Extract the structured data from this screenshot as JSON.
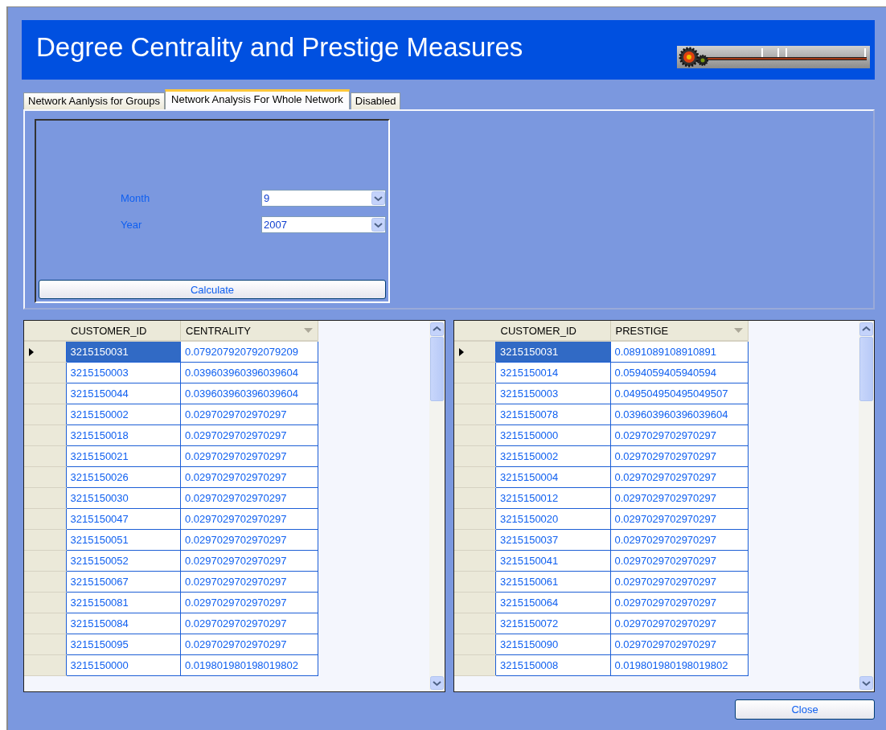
{
  "header": {
    "title": "Degree Centrality and Prestige Measures"
  },
  "tabs": [
    {
      "label": "Network Aanlysis for Groups",
      "selected": false
    },
    {
      "label": "Network Analysis For Whole Network",
      "selected": true
    },
    {
      "label": "Disabled",
      "selected": false
    }
  ],
  "form": {
    "fields": [
      {
        "label": "Month",
        "value": "9"
      },
      {
        "label": "Year",
        "value": "2007"
      }
    ],
    "calculate_button": "Calculate"
  },
  "grids": [
    {
      "columns": [
        "CUSTOMER_ID",
        "CENTRALITY"
      ],
      "rows": [
        {
          "cells": [
            "3215150031",
            "0.079207920792079209"
          ],
          "selected": true
        },
        {
          "cells": [
            "3215150003",
            "0.039603960396039604"
          ],
          "selected": false
        },
        {
          "cells": [
            "3215150044",
            "0.039603960396039604"
          ],
          "selected": false
        },
        {
          "cells": [
            "3215150002",
            "0.0297029702970297"
          ],
          "selected": false
        },
        {
          "cells": [
            "3215150018",
            "0.0297029702970297"
          ],
          "selected": false
        },
        {
          "cells": [
            "3215150021",
            "0.0297029702970297"
          ],
          "selected": false
        },
        {
          "cells": [
            "3215150026",
            "0.0297029702970297"
          ],
          "selected": false
        },
        {
          "cells": [
            "3215150030",
            "0.0297029702970297"
          ],
          "selected": false
        },
        {
          "cells": [
            "3215150047",
            "0.0297029702970297"
          ],
          "selected": false
        },
        {
          "cells": [
            "3215150051",
            "0.0297029702970297"
          ],
          "selected": false
        },
        {
          "cells": [
            "3215150052",
            "0.0297029702970297"
          ],
          "selected": false
        },
        {
          "cells": [
            "3215150067",
            "0.0297029702970297"
          ],
          "selected": false
        },
        {
          "cells": [
            "3215150081",
            "0.0297029702970297"
          ],
          "selected": false
        },
        {
          "cells": [
            "3215150084",
            "0.0297029702970297"
          ],
          "selected": false
        },
        {
          "cells": [
            "3215150095",
            "0.0297029702970297"
          ],
          "selected": false
        },
        {
          "cells": [
            "3215150000",
            "0.019801980198019802"
          ],
          "selected": false
        }
      ]
    },
    {
      "columns": [
        "CUSTOMER_ID",
        "PRESTIGE"
      ],
      "rows": [
        {
          "cells": [
            "3215150031",
            "0.0891089108910891"
          ],
          "selected": true
        },
        {
          "cells": [
            "3215150014",
            "0.0594059405940594"
          ],
          "selected": false
        },
        {
          "cells": [
            "3215150003",
            "0.049504950495049507"
          ],
          "selected": false
        },
        {
          "cells": [
            "3215150078",
            "0.039603960396039604"
          ],
          "selected": false
        },
        {
          "cells": [
            "3215150000",
            "0.0297029702970297"
          ],
          "selected": false
        },
        {
          "cells": [
            "3215150002",
            "0.0297029702970297"
          ],
          "selected": false
        },
        {
          "cells": [
            "3215150004",
            "0.0297029702970297"
          ],
          "selected": false
        },
        {
          "cells": [
            "3215150012",
            "0.0297029702970297"
          ],
          "selected": false
        },
        {
          "cells": [
            "3215150020",
            "0.0297029702970297"
          ],
          "selected": false
        },
        {
          "cells": [
            "3215150037",
            "0.0297029702970297"
          ],
          "selected": false
        },
        {
          "cells": [
            "3215150041",
            "0.0297029702970297"
          ],
          "selected": false
        },
        {
          "cells": [
            "3215150061",
            "0.0297029702970297"
          ],
          "selected": false
        },
        {
          "cells": [
            "3215150064",
            "0.0297029702970297"
          ],
          "selected": false
        },
        {
          "cells": [
            "3215150072",
            "0.0297029702970297"
          ],
          "selected": false
        },
        {
          "cells": [
            "3215150090",
            "0.0297029702970297"
          ],
          "selected": false
        },
        {
          "cells": [
            "3215150008",
            "0.019801980198019802"
          ],
          "selected": false
        }
      ]
    }
  ],
  "close_button": "Close"
}
